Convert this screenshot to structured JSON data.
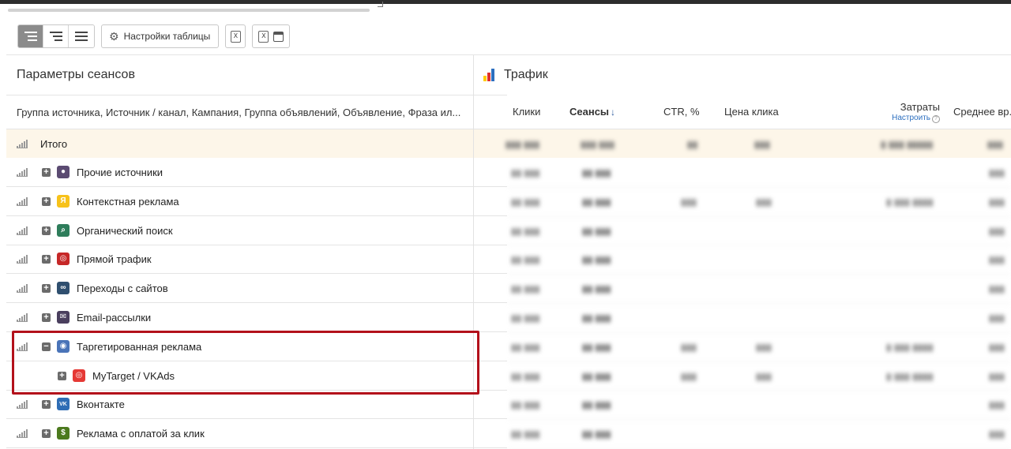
{
  "toolbar": {
    "table_settings_label": "Настройки таблицы"
  },
  "panel": {
    "title": "Параметры сеансов",
    "dimensions": "Группа источника, Источник / канал, Кампания, Группа объявлений, Объявление, Фраза ил..."
  },
  "traffic": {
    "title": "Трафик",
    "logo_colors": [
      "#ffcc00",
      "#e0312b",
      "#2c6fbf"
    ]
  },
  "columns": {
    "clicks": "Клики",
    "sessions": "Сеансы",
    "sessions_sort": "↓",
    "ctr": "CTR, %",
    "cpc": "Цена клика",
    "costs": "Затраты",
    "costs_link": "Настроить",
    "costs_help": "?",
    "avg_time": "Среднее вр..."
  },
  "total": {
    "label": "Итого"
  },
  "rows": [
    {
      "label": "Прочие источники",
      "icon": "other-sources-icon",
      "icon_color": "#5b4b72",
      "expand": "+"
    },
    {
      "label": "Контекстная реклама",
      "icon": "yandex-icon",
      "icon_color": "#f7c21a",
      "expand": "+"
    },
    {
      "label": "Органический поиск",
      "icon": "search-icon",
      "icon_color": "#2e7d5b",
      "expand": "+"
    },
    {
      "label": "Прямой трафик",
      "icon": "direct-icon",
      "icon_color": "#c62828",
      "expand": "+"
    },
    {
      "label": "Переходы с сайтов",
      "icon": "link-icon",
      "icon_color": "#2f4f6f",
      "expand": "+"
    },
    {
      "label": "Email-рассылки",
      "icon": "mail-icon",
      "icon_color": "#4a3f5e",
      "expand": "+"
    },
    {
      "label": "Таргетированная реклама",
      "icon": "target-icon",
      "icon_color": "#4a74b8",
      "expand": "−"
    },
    {
      "label": "MyTarget / VKAds",
      "icon": "mytarget-icon",
      "icon_color": "#e53935",
      "expand": "+"
    },
    {
      "label": "Вконтакте",
      "icon": "vk-icon",
      "icon_color": "#2f6db5",
      "expand": "+"
    },
    {
      "label": "Реклама с оплатой за клик",
      "icon": "ppc-icon",
      "icon_color": "#4c7a1e",
      "expand": "+"
    }
  ],
  "highlight_color": "#b3111b"
}
